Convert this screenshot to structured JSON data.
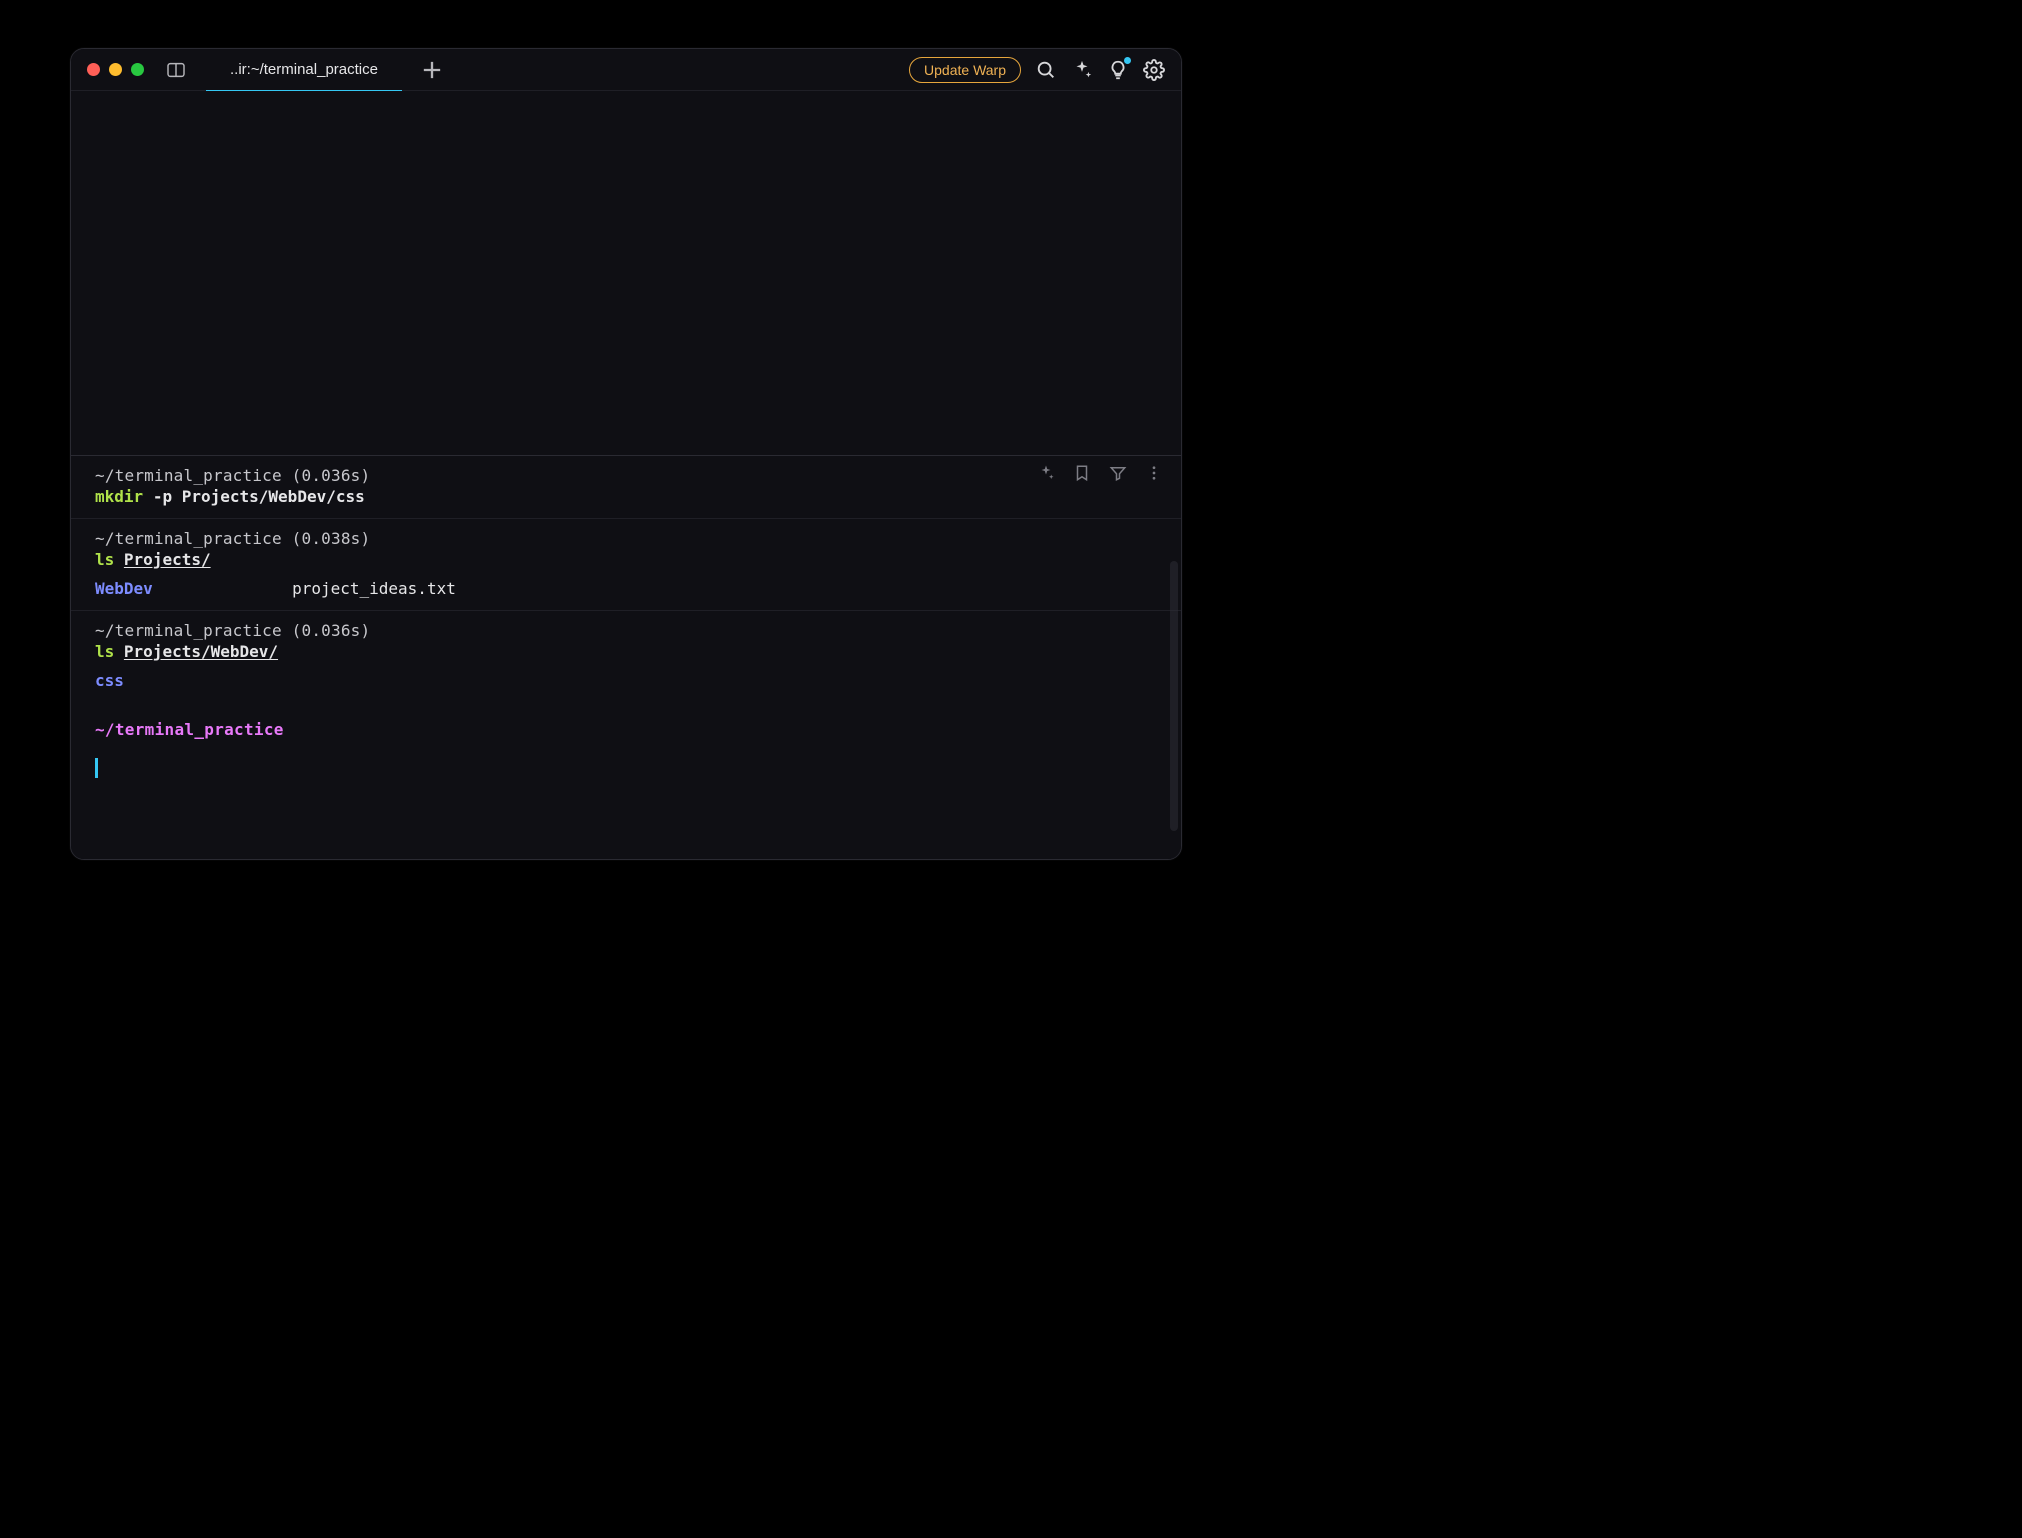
{
  "tab_title": "..ir:~/terminal_practice",
  "update_label": "Update Warp",
  "blocks": [
    {
      "meta": "~/terminal_practice (0.036s)",
      "cmd": "mkdir",
      "flag": "-p",
      "arg": "Projects/WebDev/css",
      "arg_underline": false,
      "output": null,
      "show_actions": true
    },
    {
      "meta": "~/terminal_practice (0.038s)",
      "cmd": "ls",
      "flag": "",
      "arg": "Projects/",
      "arg_underline": true,
      "output": {
        "dir": "WebDev",
        "file": "project_ideas.txt"
      },
      "show_actions": false
    },
    {
      "meta": "~/terminal_practice (0.036s)",
      "cmd": "ls",
      "flag": "",
      "arg": "Projects/WebDev/",
      "arg_underline": true,
      "output": {
        "dir": "css",
        "file": ""
      },
      "show_actions": false
    }
  ],
  "prompt_cwd": "~/terminal_practice"
}
